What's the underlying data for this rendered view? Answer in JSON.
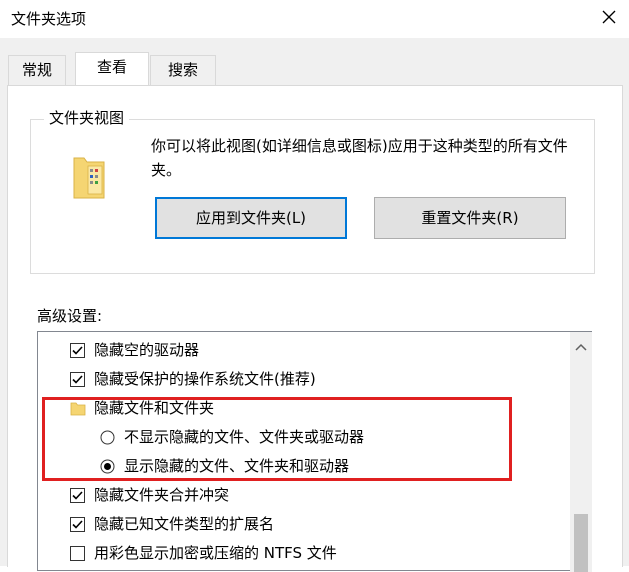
{
  "window": {
    "title": "文件夹选项"
  },
  "tabs": [
    {
      "label": "常规",
      "active": false
    },
    {
      "label": "查看",
      "active": true
    },
    {
      "label": "搜索",
      "active": false
    }
  ],
  "folder_views": {
    "legend": "文件夹视图",
    "description": "你可以将此视图(如详细信息或图标)应用于这种类型的所有文件夹。",
    "apply_button": "应用到文件夹(L)",
    "reset_button": "重置文件夹(R)"
  },
  "advanced": {
    "label": "高级设置:",
    "items": [
      {
        "type": "checkbox",
        "checked": true,
        "label": "隐藏空的驱动器"
      },
      {
        "type": "checkbox",
        "checked": true,
        "label": "隐藏受保护的操作系统文件(推荐)"
      },
      {
        "type": "folder",
        "label": "隐藏文件和文件夹"
      },
      {
        "type": "radio",
        "checked": false,
        "label": "不显示隐藏的文件、文件夹或驱动器"
      },
      {
        "type": "radio",
        "checked": true,
        "label": "显示隐藏的文件、文件夹和驱动器"
      },
      {
        "type": "checkbox",
        "checked": true,
        "label": "隐藏文件夹合并冲突"
      },
      {
        "type": "checkbox",
        "checked": true,
        "label": "隐藏已知文件类型的扩展名"
      },
      {
        "type": "checkbox",
        "checked": false,
        "label": "用彩色显示加密或压缩的 NTFS 文件"
      }
    ]
  },
  "colors": {
    "accent": "#0078d7",
    "highlight": "#e02020"
  }
}
